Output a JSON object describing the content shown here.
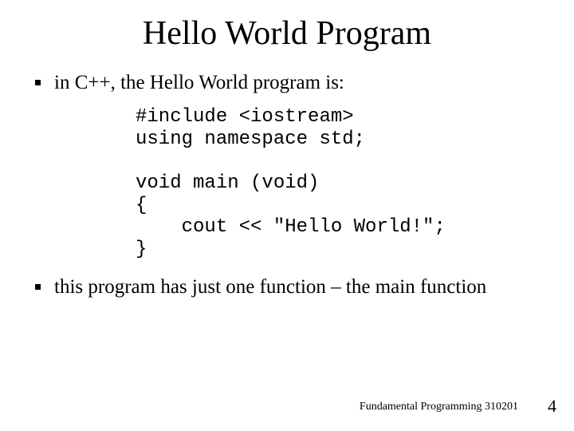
{
  "title": "Hello World Program",
  "bullets": [
    "in C++, the Hello World program is:",
    "this program has just one function – the main function"
  ],
  "code": "#include <iostream>\nusing namespace std;\n\nvoid main (void)\n{\n    cout << \"Hello World!\";\n}",
  "footer": "Fundamental Programming 310201",
  "page_number": "4"
}
